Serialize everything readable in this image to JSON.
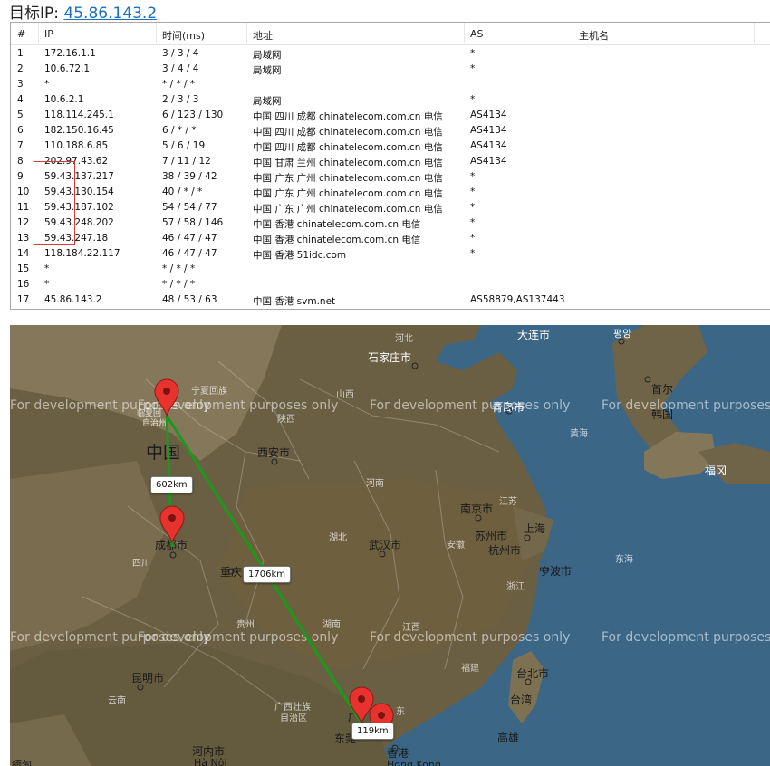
{
  "header": {
    "label": "目标IP: ",
    "ip": "45.86.143.2"
  },
  "table": {
    "columns": [
      "#",
      "IP",
      "时间(ms)",
      "地址",
      "AS",
      "主机名"
    ],
    "rows": [
      {
        "n": "1",
        "ip": "172.16.1.1",
        "time": "3 / 3 / 4",
        "addr": "局域网",
        "as": "*",
        "host": ""
      },
      {
        "n": "2",
        "ip": "10.6.72.1",
        "time": "3 / 4 / 4",
        "addr": "局域网",
        "as": "*",
        "host": ""
      },
      {
        "n": "3",
        "ip": "*",
        "time": "* / * / *",
        "addr": "",
        "as": "",
        "host": ""
      },
      {
        "n": "4",
        "ip": "10.6.2.1",
        "time": "2 / 3 / 3",
        "addr": "局域网",
        "as": "*",
        "host": ""
      },
      {
        "n": "5",
        "ip": "118.114.245.1",
        "time": "6 / 123 / 130",
        "addr": "中国 四川 成都 chinatelecom.com.cn 电信",
        "as": "AS4134",
        "host": ""
      },
      {
        "n": "6",
        "ip": "182.150.16.45",
        "time": "6 / * / *",
        "addr": "中国 四川 成都 chinatelecom.com.cn 电信",
        "as": "AS4134",
        "host": ""
      },
      {
        "n": "7",
        "ip": "110.188.6.85",
        "time": "5 / 6 / 19",
        "addr": "中国 四川 成都 chinatelecom.com.cn 电信",
        "as": "AS4134",
        "host": ""
      },
      {
        "n": "8",
        "ip": "202.97.43.62",
        "time": "7 / 11 / 12",
        "addr": "中国 甘肃 兰州 chinatelecom.com.cn 电信",
        "as": "AS4134",
        "host": ""
      },
      {
        "n": "9",
        "ip": "59.43.137.217",
        "time": "38 / 39 / 42",
        "addr": "中国 广东 广州 chinatelecom.com.cn 电信",
        "as": "*",
        "host": ""
      },
      {
        "n": "10",
        "ip": "59.43.130.154",
        "time": "40 / * / *",
        "addr": "中国 广东 广州 chinatelecom.com.cn 电信",
        "as": "*",
        "host": ""
      },
      {
        "n": "11",
        "ip": "59.43.187.102",
        "time": "54 / 54 / 77",
        "addr": "中国 广东 广州 chinatelecom.com.cn 电信",
        "as": "*",
        "host": ""
      },
      {
        "n": "12",
        "ip": "59.43.248.202",
        "time": "57 / 58 / 146",
        "addr": "中国 香港 chinatelecom.com.cn 电信",
        "as": "*",
        "host": ""
      },
      {
        "n": "13",
        "ip": "59.43.247.18",
        "time": "46 / 47 / 47",
        "addr": "中国 香港 chinatelecom.com.cn 电信",
        "as": "*",
        "host": ""
      },
      {
        "n": "14",
        "ip": "118.184.22.117",
        "time": "46 / 47 / 47",
        "addr": "中国 香港 51idc.com",
        "as": "*",
        "host": ""
      },
      {
        "n": "15",
        "ip": "*",
        "time": "* / * / *",
        "addr": "",
        "as": "",
        "host": ""
      },
      {
        "n": "16",
        "ip": "*",
        "time": "* / * / *",
        "addr": "",
        "as": "",
        "host": ""
      },
      {
        "n": "17",
        "ip": "45.86.143.2",
        "time": "48 / 53 / 63",
        "addr": "中国 香港 svm.net",
        "as": "AS58879,AS137443",
        "host": ""
      }
    ]
  },
  "map": {
    "watermark": "For development purposes only",
    "distances": [
      "602km",
      "1706km",
      "119km"
    ],
    "labels": {
      "pingyang": "평양",
      "dalian": "大连市",
      "shijiazhuang": "石家庄市",
      "hebei": "河北",
      "shanxi": "山西",
      "ningxia": "宁夏回族",
      "linxia_a": "临夏回",
      "linxia_b": "自治州",
      "shaanxi": "陕西",
      "xian": "西安市",
      "zhongguo": "中国",
      "qingdao": "青岛市",
      "huanghai": "黄海",
      "shouer_a": "首尔",
      "shouer_b": "韩国",
      "fukuoka": "福冈",
      "henan": "河南",
      "nanjing": "南京市",
      "jiangsu": "江苏",
      "shanghai": "上海",
      "suzhou": "苏州市",
      "hangzhou": "杭州市",
      "anhui": "安徽",
      "hubei": "湖北",
      "wuhan": "武汉市",
      "chengdu": "成都市",
      "sichuan": "四川",
      "chongqing": "重庆",
      "zhejiang": "浙江",
      "ningbo": "宁波市",
      "donghai": "东海",
      "guizhou": "贵州",
      "hunan": "湖南",
      "jiangxi": "江西",
      "fujian": "福建",
      "kunming": "昆明市",
      "taibei": "台北市",
      "taiwan": "台湾",
      "yunnan": "云南",
      "guangxi_a": "广西壮族",
      "guangxi_b": "自治区",
      "guang": "广",
      "dong": "东",
      "dongguan": "东莞",
      "kaohsiung": "高雄",
      "hanoi_a": "河内市",
      "hanoi_b": "Hà Nội",
      "hongkong_a": "香港",
      "hongkong_b": "Hong Kong",
      "mianma": "緬甸"
    }
  }
}
